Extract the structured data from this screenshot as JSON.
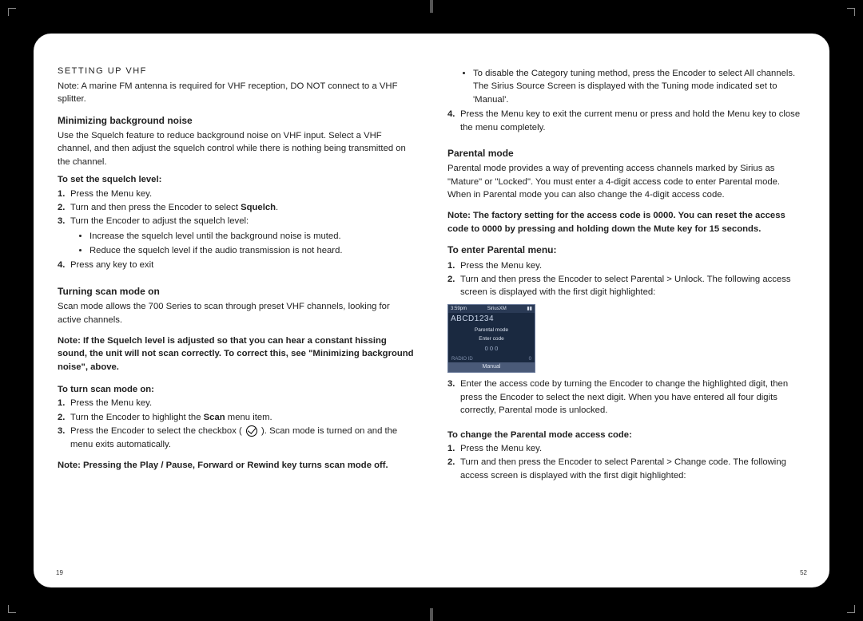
{
  "marks": {},
  "left": {
    "header": "SETTING UP VHF",
    "note1": "Note: A marine FM antenna is required for VHF reception, DO NOT connect to a VHF splitter.",
    "min_heading": "Minimizing background noise",
    "min_text": "Use the Squelch feature to reduce background noise on VHF input. Select a VHF channel, and then adjust the squelch control while there is nothing being transmitted on the channel.",
    "set_squelch_title": "To set the squelch level:",
    "sq1": "Press the Menu key.",
    "sq2a": "Turn and then press the Encoder to select ",
    "sq2b": "Squelch",
    "sq2c": ".",
    "sq3": "Turn the Encoder to adjust the squelch level:",
    "sq3_b1": "Increase the squelch level until the background noise is muted.",
    "sq3_b2": "Reduce the squelch level if the audio transmission is not heard.",
    "sq4": "Press any key to exit",
    "scan_heading": "Turning scan mode on",
    "scan_text": "Scan mode allows the 700 Series to scan through preset VHF channels, looking for active channels.",
    "scan_note": "Note: If the Squelch level is adjusted so that you can hear a constant hissing sound, the unit will not scan correctly. To correct this, see \"Minimizing background noise\", above.",
    "turn_scan_title": "To turn scan mode on:",
    "ts1": "Press the Menu key.",
    "ts2a": "Turn the Encoder to highlight the ",
    "ts2b": "Scan",
    "ts2c": " menu item.",
    "ts3a": "Press the Encoder to select the checkbox ( ",
    "ts3b": " ). Scan mode is turned on and the menu exits automatically.",
    "scan_off_note": "Note: Pressing the Play / Pause, Forward or Rewind key turns scan mode off.",
    "page_num": "19"
  },
  "right": {
    "r_bullet": "To disable the Category tuning method, press the Encoder to select All channels. The Sirius Source Screen is displayed with the Tuning mode indicated set to 'Manual'.",
    "r_step4": "Press the Menu key to exit the current menu or press and hold the Menu key to close the menu completely.",
    "pm_heading": "Parental mode",
    "pm_text": "Parental mode provides a way of preventing access channels marked by Sirius as \"Mature\" or \"Locked\". You must enter a 4-digit access code to enter Parental mode. When in Parental mode you can also change the 4-digit access code.",
    "pm_note": "Note: The factory setting for the access code is 0000. You can reset the access code to 0000 by pressing and holding down the Mute key for 15 seconds.",
    "enter_heading": "To enter Parental menu:",
    "ep1": "Press the Menu key.",
    "ep2": "Turn and then press the Encoder to select Parental > Unlock. The following access screen is displayed with the first digit highlighted:",
    "screenshot": {
      "time": "3:59pm",
      "source": "SiriusXM",
      "line1": "ABCD1234",
      "line2": "Parental mode",
      "line3": "Enter code",
      "code": "0   0   0",
      "radio": "RADIO ID",
      "zero": "0",
      "manual": "Manual"
    },
    "ep3": "Enter the access code by turning the Encoder to change the highlighted digit, then press the Encoder to select the next digit. When you have entered all four digits correctly, Parental mode is unlocked.",
    "change_title": "To change the Parental mode access code:",
    "cc1": "Press the Menu key.",
    "cc2": "Turn and then press the Encoder to select Parental > Change code. The following access screen is displayed with the first digit highlighted:",
    "page_num": "52"
  }
}
